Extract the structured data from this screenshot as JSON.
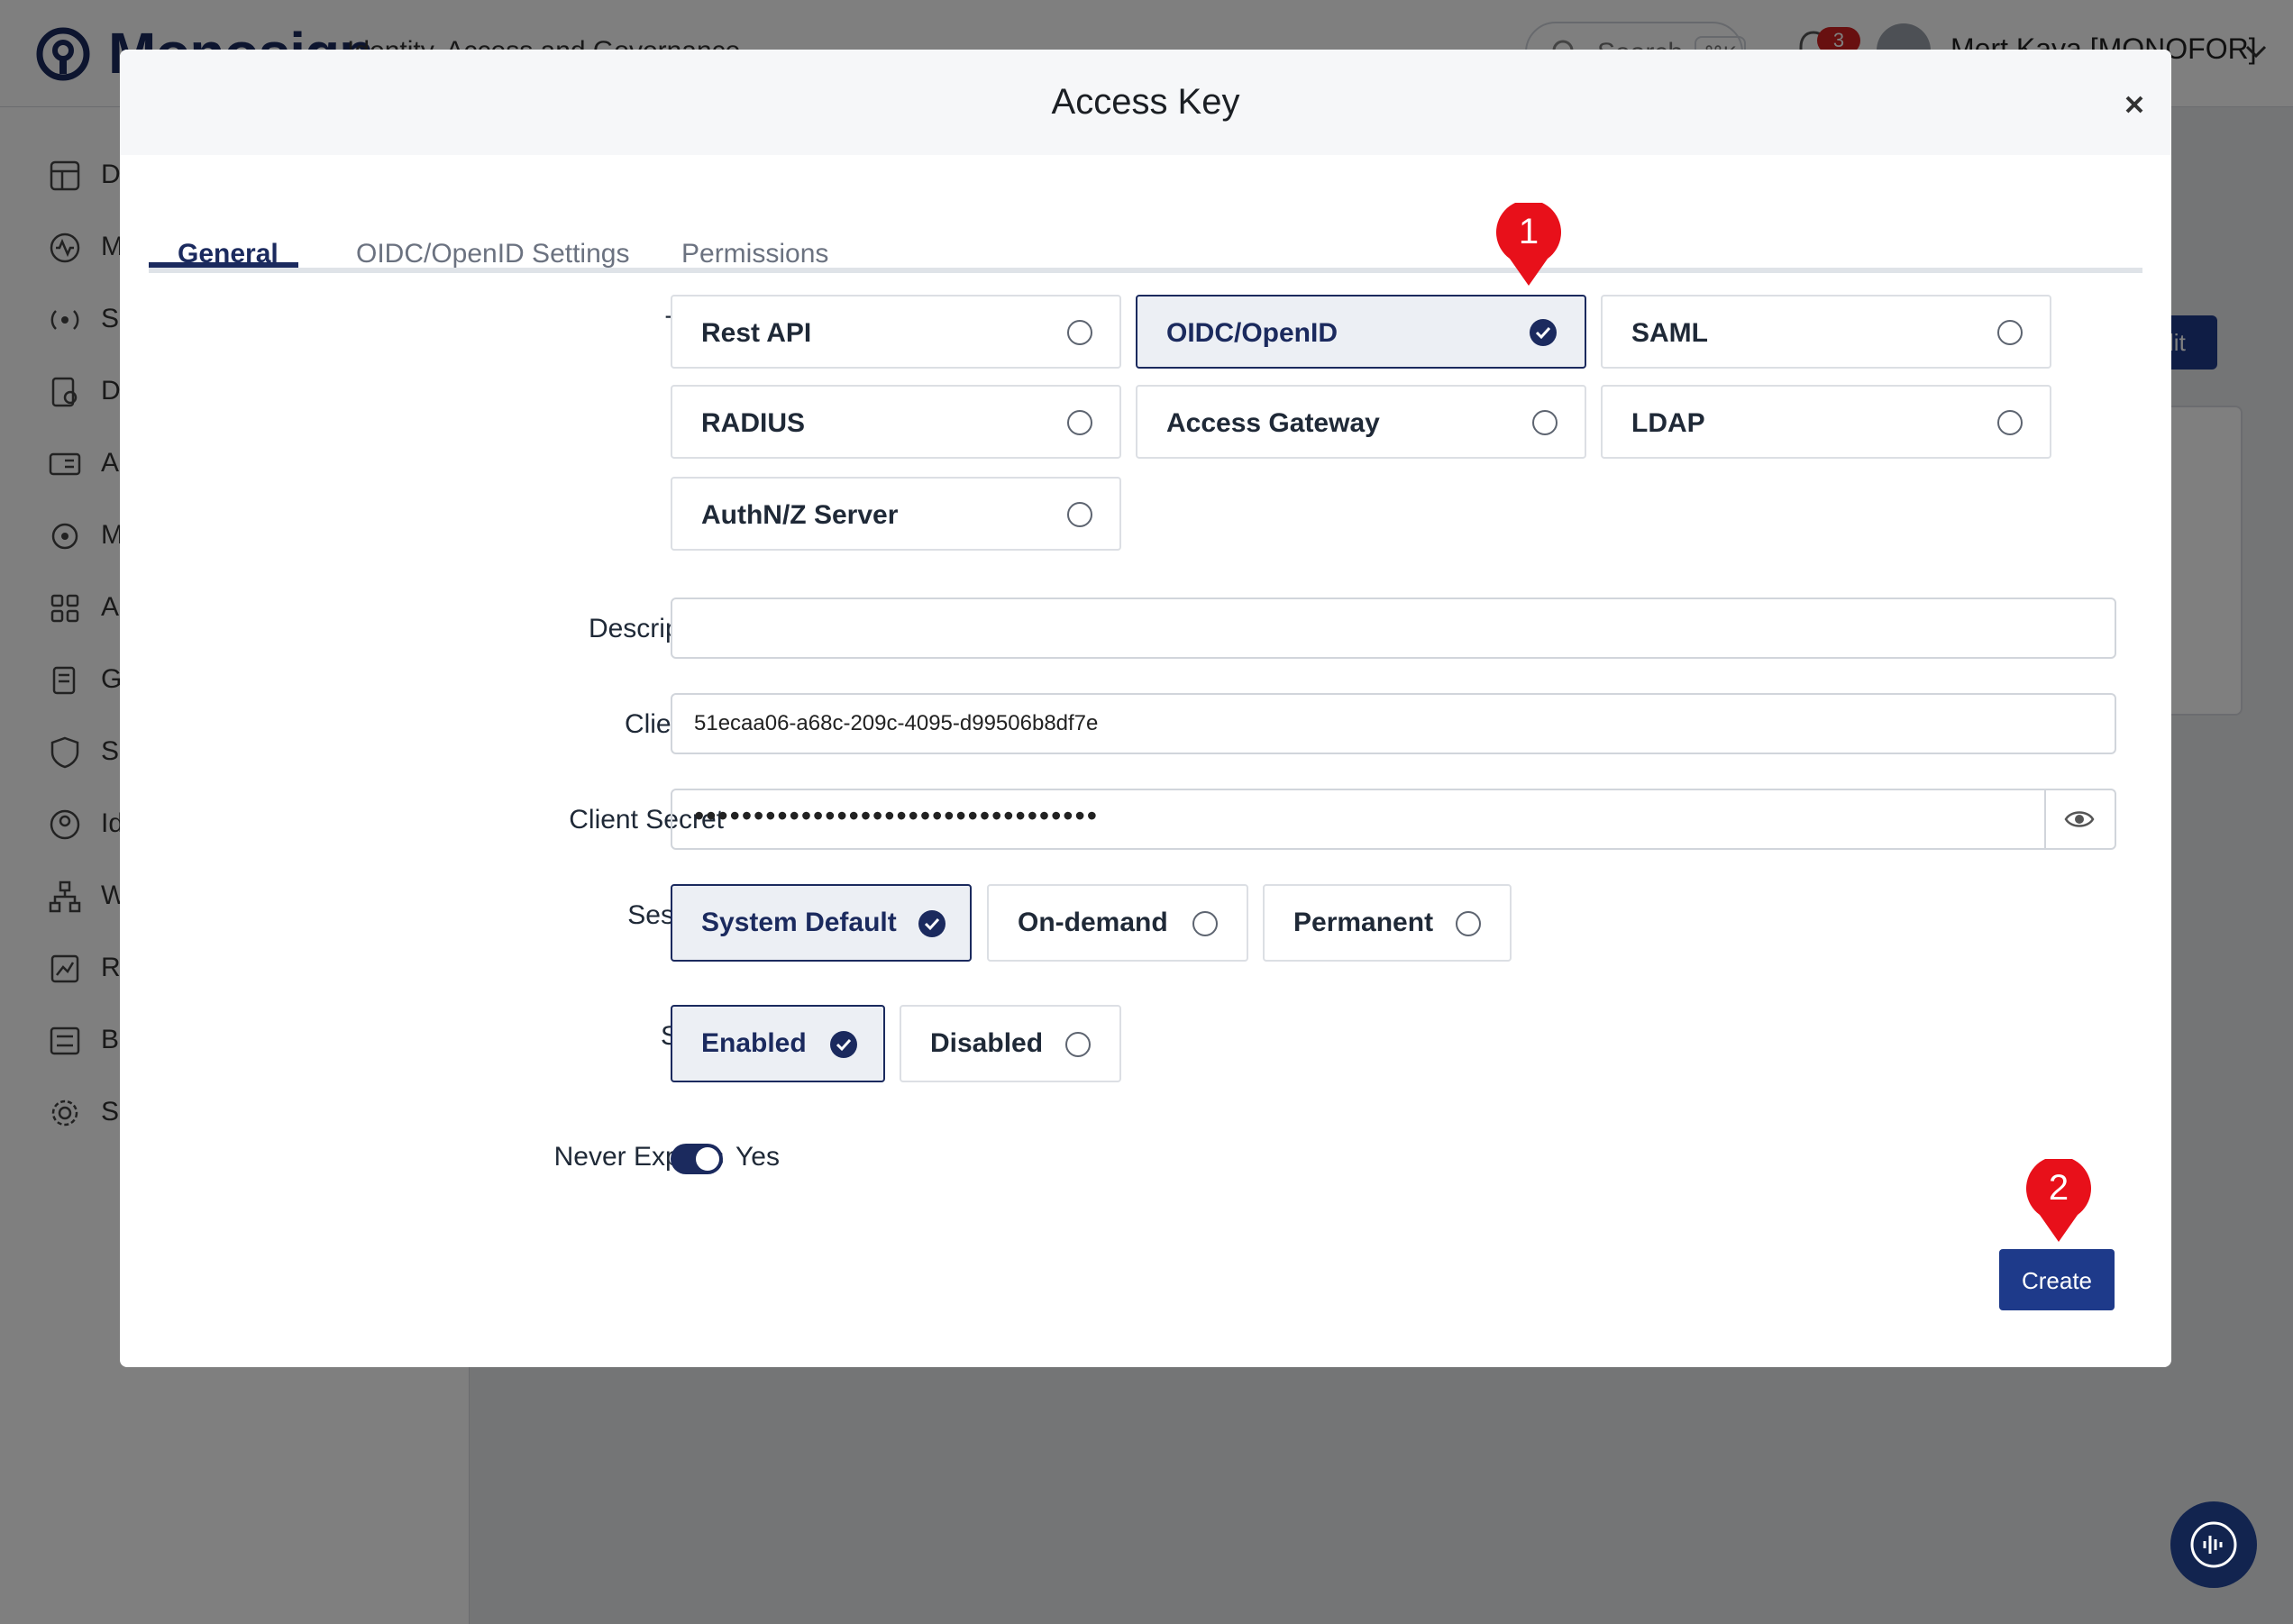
{
  "app": {
    "brand": "Monosign",
    "subtitle": "Identity, Access and Governance",
    "search_placeholder": "Search",
    "search_shortcut": "⌘K",
    "notification_count": "3",
    "user_name": "Mert Kaya [MONOFOR]",
    "sidebar_items": [
      "D",
      "M",
      "S",
      "D",
      "A",
      "M",
      "A",
      "G",
      "S",
      "Id",
      "W",
      "R",
      "B",
      "S"
    ],
    "edit_button": "Edit"
  },
  "modal": {
    "title": "Access Key",
    "tabs": [
      "General",
      "OIDC/OpenID Settings",
      "Permissions"
    ],
    "active_tab": "General",
    "labels": {
      "type": "Type",
      "description": "Description",
      "client_id": "Client Id",
      "client_secret": "Client Secret",
      "session": "Session",
      "state": "State",
      "never_expires": "Never Expires"
    },
    "type_options": [
      "Rest API",
      "OIDC/OpenID",
      "SAML",
      "RADIUS",
      "Access Gateway",
      "LDAP",
      "AuthN/Z Server"
    ],
    "type_selected": "OIDC/OpenID",
    "description_value": "",
    "client_id_value": "51ecaa06-a68c-209c-4095-d99506b8df7e",
    "client_secret_masked": "••••••••••••••••••••••••••••••••••",
    "session_options": [
      "System Default",
      "On-demand",
      "Permanent"
    ],
    "session_selected": "System Default",
    "state_options": [
      "Enabled",
      "Disabled"
    ],
    "state_selected": "Enabled",
    "never_expires": true,
    "never_expires_text": "Yes",
    "create_button": "Create"
  },
  "markers": [
    "1",
    "2"
  ],
  "colors": {
    "primary": "#1b2a5e",
    "button": "#1e3a8a",
    "marker": "#e8101a",
    "selected_bg": "#eceff4"
  }
}
